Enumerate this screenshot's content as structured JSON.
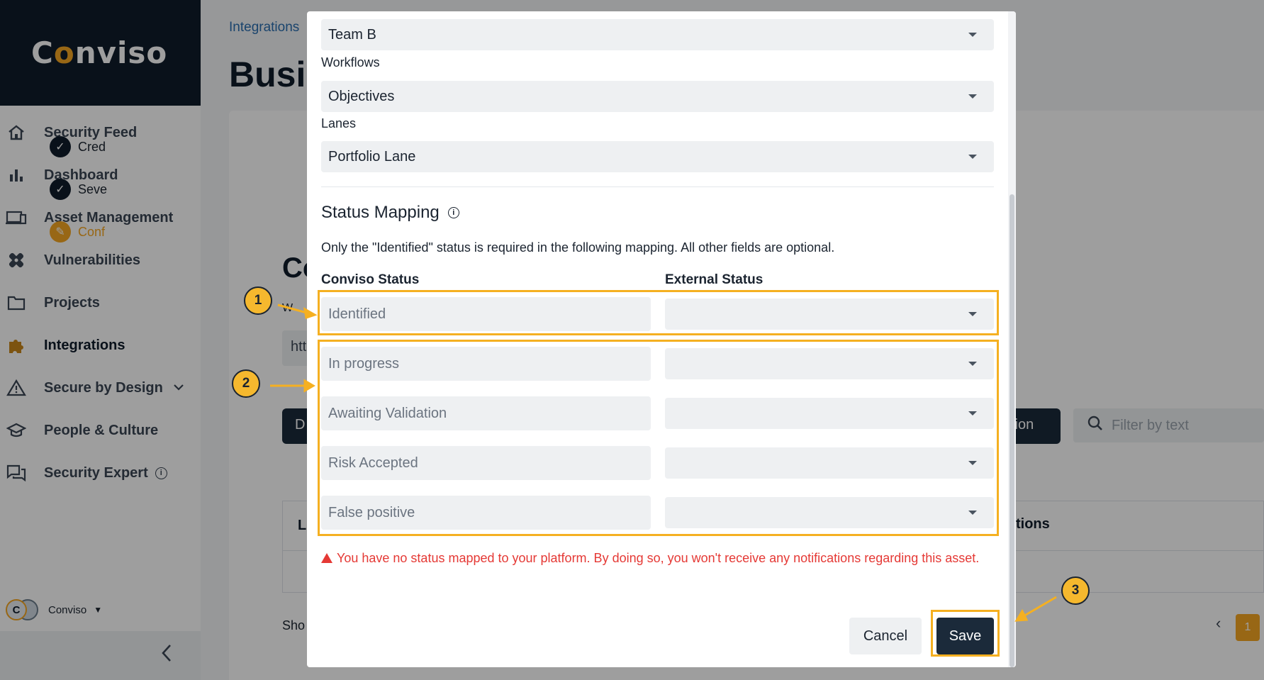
{
  "brand": {
    "name_pre": "C",
    "name_o": "o",
    "name_post": "nviso"
  },
  "sidebar": {
    "items": [
      {
        "label": "Security Feed",
        "icon": "home-icon"
      },
      {
        "label": "Dashboard",
        "icon": "bar-chart-icon"
      },
      {
        "label": "Asset Management",
        "icon": "devices-icon"
      },
      {
        "label": "Vulnerabilities",
        "icon": "bandage-icon"
      },
      {
        "label": "Projects",
        "icon": "folder-icon"
      },
      {
        "label": "Integrations",
        "icon": "puzzle-icon"
      },
      {
        "label": "Secure by Design",
        "icon": "warning-icon"
      },
      {
        "label": "People & Culture",
        "icon": "graduation-cap-icon"
      },
      {
        "label": "Security Expert",
        "icon": "chat-icon"
      }
    ],
    "user_name": "Conviso",
    "avatar_letter": "C"
  },
  "background": {
    "breadcrumb": "Integrations",
    "page_title_partial": "Busir",
    "steps": [
      "Cred",
      "Seve",
      "Conf"
    ],
    "section_partial": "Co",
    "w_partial": "W",
    "input_partial": "htt",
    "button_partial": "D",
    "action_partial": "ction",
    "filter_placeholder": "Filter by text",
    "col_l_partial": "L",
    "col_actions_partial": "tions",
    "show_partial": "Sho",
    "pager_prev": "‹",
    "pager_page": "1"
  },
  "modal": {
    "team_value": "Team B",
    "workflows_label": "Workflows",
    "workflows_value": "Objectives",
    "lanes_label": "Lanes",
    "lanes_value": "Portfolio Lane",
    "status_mapping_title": "Status Mapping",
    "status_mapping_desc": "Only the \"Identified\" status is required in the following mapping. All other fields are optional.",
    "col_conviso": "Conviso Status",
    "col_external": "External Status",
    "statuses": [
      "Identified",
      "In progress",
      "Awaiting Validation",
      "Risk Accepted",
      "False positive"
    ],
    "warning": "You have no status mapped to your platform. By doing so, you won't receive any notifications regarding this asset.",
    "cancel_label": "Cancel",
    "save_label": "Save"
  },
  "annotations": {
    "badge1": "1",
    "badge2": "2",
    "badge3": "3"
  },
  "colors": {
    "accent": "#f5b021",
    "dark": "#1b2a3a",
    "error": "#e53935",
    "link": "#2a6fb0"
  }
}
